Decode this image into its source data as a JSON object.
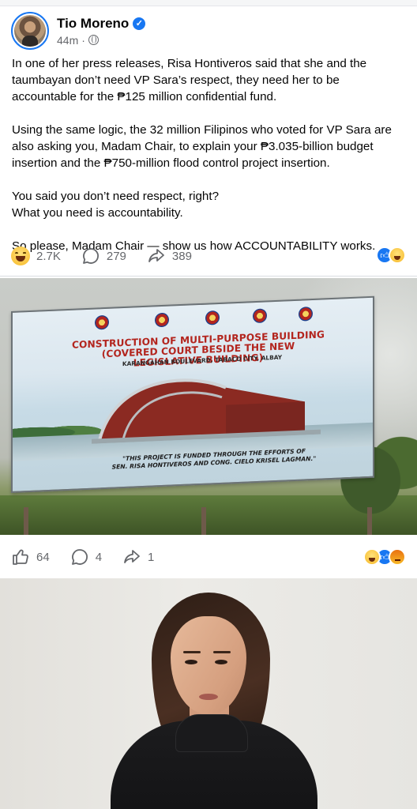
{
  "post": {
    "author": "Tio Moreno",
    "verified": true,
    "time": "44m",
    "visibility_icon": "globe-icon",
    "paragraphs": [
      "In one of her press releases, Risa Hontiveros said that she and the taumbayan don’t need VP Sara’s respect, they need her to be accountable for the ₱125 million confidential fund.",
      "Using the same logic, the 32 million Filipinos who voted for VP Sara are also asking you, Madam Chair, to explain your ₱3.035-billion budget insertion and the ₱750-million flood control project insertion.",
      "You said you don’t need respect, right?",
      "What you need is accountability.",
      "So please, Madam Chair — show us how ACCOUNTABILITY works."
    ],
    "reactions_count": "2.7K",
    "comments_count": "279",
    "shares_count": "389"
  },
  "shared_post": {
    "billboard": {
      "title_line1": "CONSTRUCTION OF MULTI-PURPOSE BUILDING",
      "title_line2": "(COVERED COURT BESIDE THE NEW LEGISLATIVE BUILDING)",
      "subtitle": "KARANGAHAN BOULEVARD, TABACO CITY, ALBAY",
      "note_line1": "\"THIS PROJECT IS FUNDED THROUGH THE EFFORTS OF",
      "note_line2": "SEN. RISA HONTIVEROS AND CONG. CIELO KRISEL LAGMAN.\""
    },
    "likes_count": "64",
    "comments_count": "4",
    "shares_count": "1"
  },
  "colors": {
    "accent": "#1877f2",
    "meta_text": "#65676b",
    "billboard_red": "#b3251e"
  }
}
